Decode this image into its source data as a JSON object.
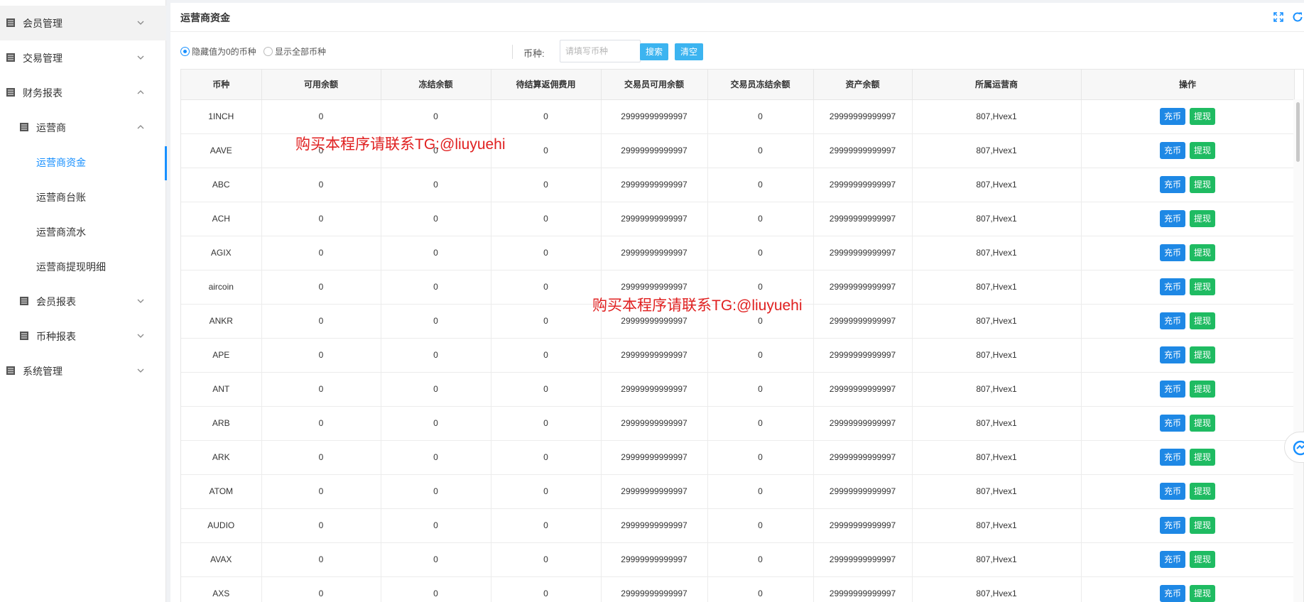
{
  "sidebar": {
    "items": [
      {
        "label": "会员管理",
        "arrow": "down"
      },
      {
        "label": "交易管理",
        "arrow": "down"
      },
      {
        "label": "财务报表",
        "arrow": "up"
      },
      {
        "label": "运营商",
        "arrow": "up"
      },
      {
        "label": "运营商资金"
      },
      {
        "label": "运营商台账"
      },
      {
        "label": "运营商流水"
      },
      {
        "label": "运营商提现明细"
      },
      {
        "label": "会员报表",
        "arrow": "down"
      },
      {
        "label": "币种报表",
        "arrow": "down"
      },
      {
        "label": "系统管理",
        "arrow": "down"
      }
    ]
  },
  "page": {
    "title": "运营商资金"
  },
  "filters": {
    "radio_hide_zero": "隐藏值为0的币种",
    "radio_show_all": "显示全部币种",
    "selected": "hide_zero",
    "coin_label": "币种:",
    "coin_placeholder": "请填写币种",
    "coin_value": "",
    "search_button": "搜索",
    "clear_button": "清空"
  },
  "table": {
    "columns": [
      "币种",
      "可用余额",
      "冻结余额",
      "待结算返佣费用",
      "交易员可用余额",
      "交易员冻结余额",
      "资产余额",
      "所属运营商",
      "操作"
    ],
    "rows": [
      [
        "1INCH",
        "0",
        "0",
        "0",
        "29999999999997",
        "0",
        "29999999999997",
        "807,Hvex1"
      ],
      [
        "AAVE",
        "0",
        "0",
        "0",
        "29999999999997",
        "0",
        "29999999999997",
        "807,Hvex1"
      ],
      [
        "ABC",
        "0",
        "0",
        "0",
        "29999999999997",
        "0",
        "29999999999997",
        "807,Hvex1"
      ],
      [
        "ACH",
        "0",
        "0",
        "0",
        "29999999999997",
        "0",
        "29999999999997",
        "807,Hvex1"
      ],
      [
        "AGIX",
        "0",
        "0",
        "0",
        "29999999999997",
        "0",
        "29999999999997",
        "807,Hvex1"
      ],
      [
        "aircoin",
        "0",
        "0",
        "0",
        "29999999999997",
        "0",
        "29999999999997",
        "807,Hvex1"
      ],
      [
        "ANKR",
        "0",
        "0",
        "0",
        "29999999999997",
        "0",
        "29999999999997",
        "807,Hvex1"
      ],
      [
        "APE",
        "0",
        "0",
        "0",
        "29999999999997",
        "0",
        "29999999999997",
        "807,Hvex1"
      ],
      [
        "ANT",
        "0",
        "0",
        "0",
        "29999999999997",
        "0",
        "29999999999997",
        "807,Hvex1"
      ],
      [
        "ARB",
        "0",
        "0",
        "0",
        "29999999999997",
        "0",
        "29999999999997",
        "807,Hvex1"
      ],
      [
        "ARK",
        "0",
        "0",
        "0",
        "29999999999997",
        "0",
        "29999999999997",
        "807,Hvex1"
      ],
      [
        "ATOM",
        "0",
        "0",
        "0",
        "29999999999997",
        "0",
        "29999999999997",
        "807,Hvex1"
      ],
      [
        "AUDIO",
        "0",
        "0",
        "0",
        "29999999999997",
        "0",
        "29999999999997",
        "807,Hvex1"
      ],
      [
        "AVAX",
        "0",
        "0",
        "0",
        "29999999999997",
        "0",
        "29999999999997",
        "807,Hvex1"
      ],
      [
        "AXS",
        "0",
        "0",
        "0",
        "29999999999997",
        "0",
        "29999999999997",
        "807,Hvex1"
      ]
    ],
    "actions": {
      "deposit": "充币",
      "withdraw": "提现"
    }
  },
  "watermark": {
    "text": "购买本程序请联系TG:@liuyuehi"
  },
  "colors": {
    "accent": "#1890ff",
    "search_button": "#3cb4f0",
    "deposit_button": "#1e88e5",
    "withdraw_button": "#1fbb62",
    "watermark": "#e02020"
  },
  "icons": {
    "menu": "list-icon",
    "fullscreen": "fullscreen-icon",
    "refresh": "refresh-icon",
    "float": "assistant-icon"
  }
}
